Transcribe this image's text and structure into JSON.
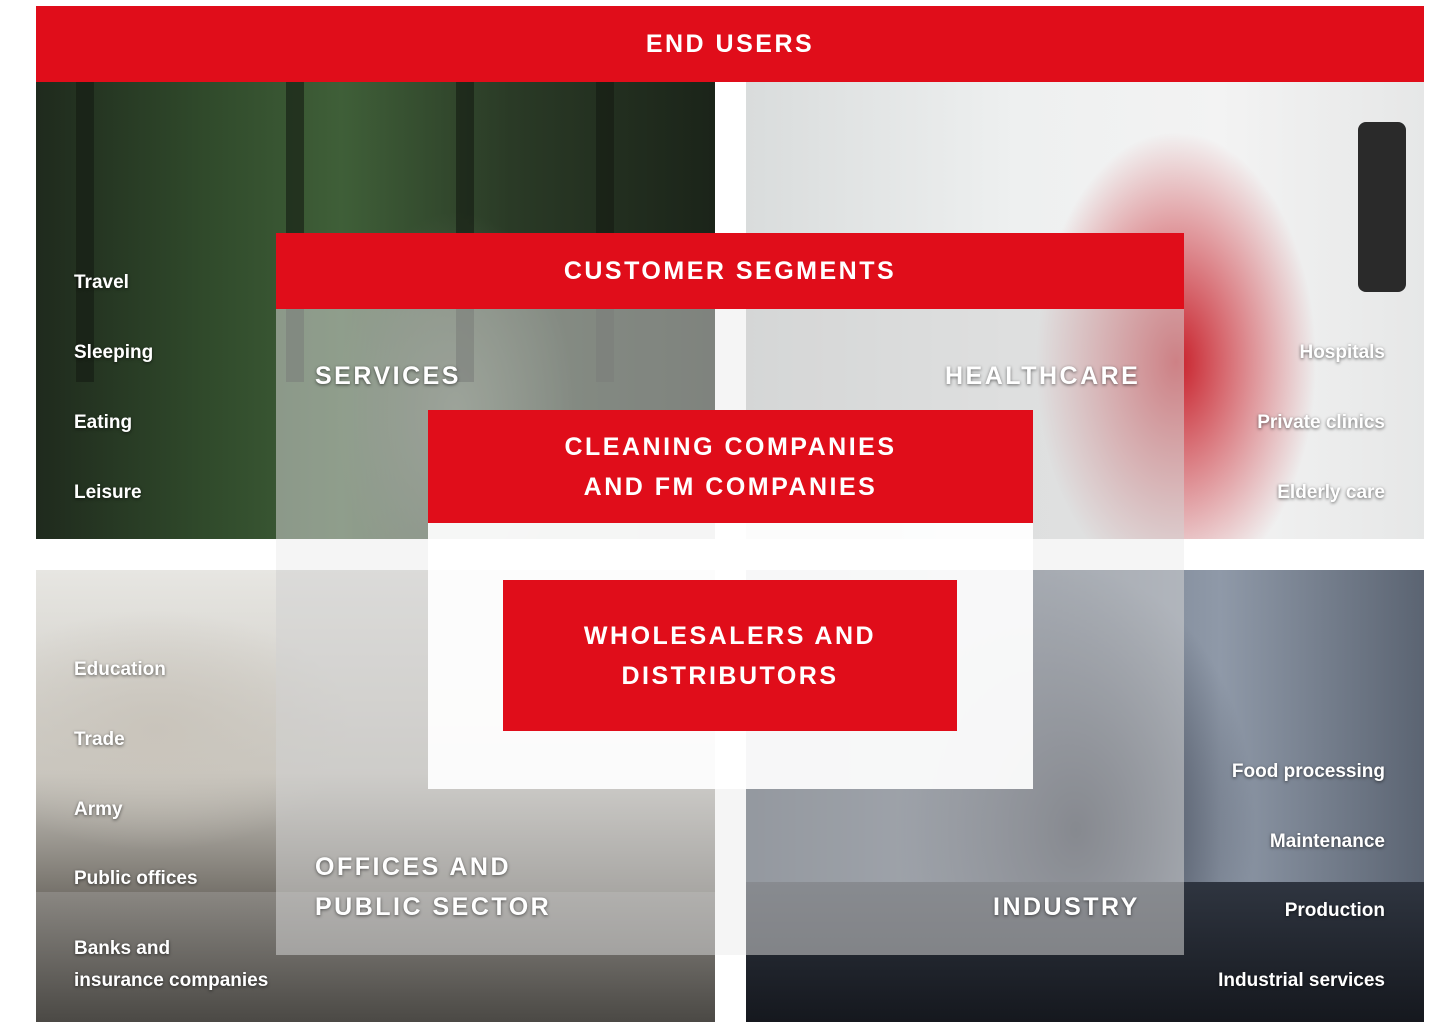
{
  "bands": {
    "end_users": "END USERS",
    "customer_segments": "CUSTOMER SEGMENTS",
    "cleaning_line1": "CLEANING COMPANIES",
    "cleaning_line2": "AND FM COMPANIES",
    "wholesalers_line1": "WHOLESALERS AND",
    "wholesalers_line2": "DISTRIBUTORS"
  },
  "segments": {
    "services": {
      "title": "SERVICES",
      "items": [
        "Travel",
        "Sleeping",
        "Eating",
        "Leisure"
      ]
    },
    "healthcare": {
      "title": "HEALTHCARE",
      "items": [
        "Hospitals",
        "Private clinics",
        "Elderly care"
      ]
    },
    "offices": {
      "title_line1": "OFFICES AND",
      "title_line2": "PUBLIC SECTOR",
      "items": [
        "Education",
        "Trade",
        "Army",
        "Public offices",
        "Banks and",
        "insurance companies"
      ]
    },
    "industry": {
      "title": "INDUSTRY",
      "items": [
        "Food processing",
        "Maintenance",
        "Production",
        "Industrial services"
      ]
    }
  },
  "colors": {
    "accent_red": "#e00d1a",
    "text": "#ffffff"
  }
}
